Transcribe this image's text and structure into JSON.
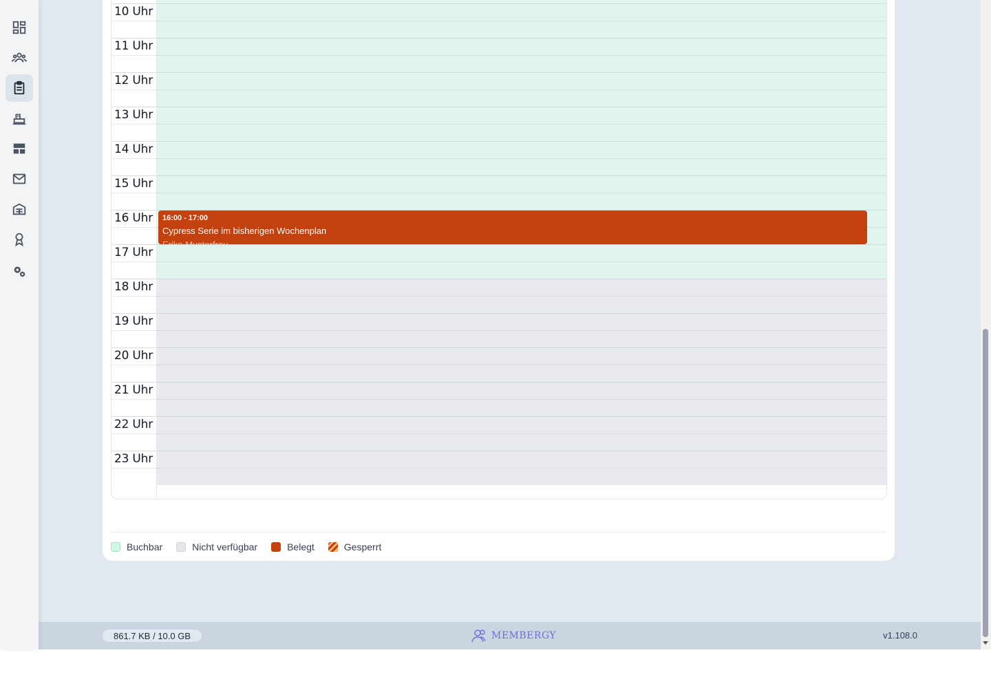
{
  "sidebar": {
    "items": [
      {
        "icon": "dashboard-icon"
      },
      {
        "icon": "members-icon"
      },
      {
        "icon": "clipboard-icon",
        "active": true
      },
      {
        "icon": "court-icon"
      },
      {
        "icon": "layout-icon"
      },
      {
        "icon": "mail-icon"
      },
      {
        "icon": "building-icon"
      },
      {
        "icon": "award-icon"
      },
      {
        "icon": "settings-icon"
      }
    ]
  },
  "calendar": {
    "hours": [
      "10 Uhr",
      "11 Uhr",
      "12 Uhr",
      "13 Uhr",
      "14 Uhr",
      "15 Uhr",
      "16 Uhr",
      "17 Uhr",
      "18 Uhr",
      "19 Uhr",
      "20 Uhr",
      "21 Uhr",
      "22 Uhr",
      "23 Uhr"
    ],
    "available_until_hour": 18,
    "event": {
      "time": "16:00 - 17:00",
      "title": "Cypress Serie im bisherigen Wochenplan",
      "person": "Erika Musterfrau"
    }
  },
  "legend": {
    "available": "Buchbar",
    "unavailable": "Nicht verfügbar",
    "booked": "Belegt",
    "blocked": "Gesperrt"
  },
  "footer": {
    "storage": "861.7 KB / 10.0 GB",
    "brand": "MEMBERGY",
    "version": "v1.108.0"
  },
  "colors": {
    "available": "#e0f5ee",
    "unavailable": "#e8eaef",
    "booked": "#c2410c",
    "brand": "#6d6fd6"
  }
}
